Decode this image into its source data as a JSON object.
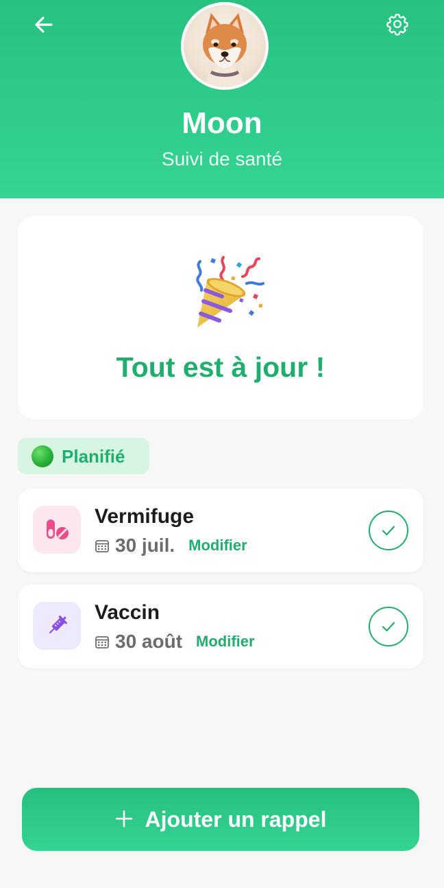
{
  "header": {
    "back_icon": "arrow-left-icon",
    "settings_icon": "gear-icon",
    "pet_name": "Moon",
    "subtitle": "Suivi de santé",
    "accent_color": "#27c180"
  },
  "status": {
    "icon": "party-popper-icon",
    "message": "Tout est à jour !"
  },
  "section": {
    "status_icon": "green-circle-icon",
    "label": "Planifié"
  },
  "reminders": [
    {
      "icon": "pill-icon",
      "title": "Vermifuge",
      "date_icon": "calendar-icon",
      "date": "30 juil.",
      "edit_label": "Modifier",
      "done_icon": "check-circle-icon"
    },
    {
      "icon": "syringe-icon",
      "title": "Vaccin",
      "date_icon": "calendar-icon",
      "date": "30 août",
      "edit_label": "Modifier",
      "done_icon": "check-circle-icon"
    }
  ],
  "footer": {
    "add_icon": "plus-icon",
    "add_label": "Ajouter un rappel"
  }
}
